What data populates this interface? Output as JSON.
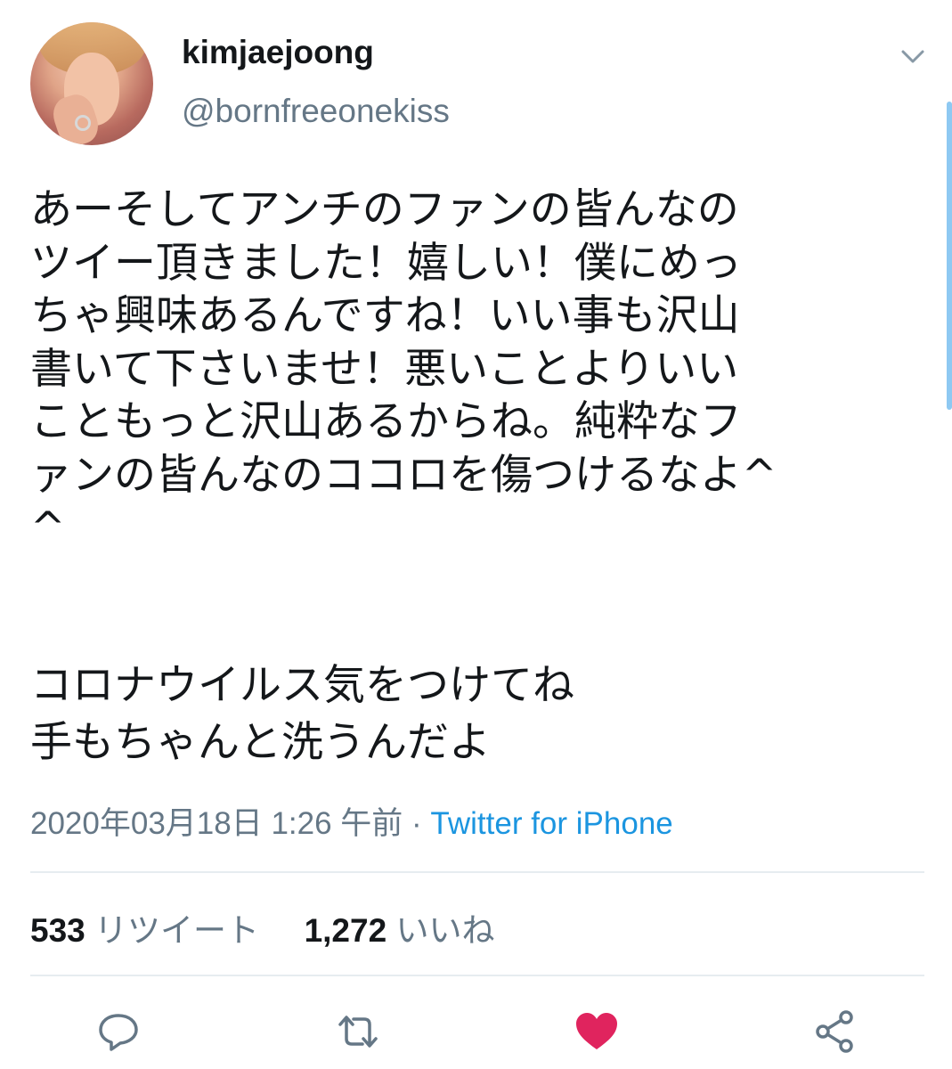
{
  "user": {
    "display_name": "kimjaejoong",
    "handle": "@bornfreeonekiss"
  },
  "tweet": {
    "text_main": "あーそしてアンチのファンの皆んなの\nツイー頂きました！嬉しい！僕にめっ\nちゃ興味あるんですね！いい事も沢山\n書いて下さいませ！悪いことよりいい\nこともっと沢山あるからね。純粋なフ\nァンの皆んなのココロを傷つけるなよ^\n^",
    "text_second": "コロナウイルス気をつけてね\n手もちゃんと洗うんだよ",
    "timestamp": "2020年03月18日 1:26 午前",
    "separator": " · ",
    "source": "Twitter for iPhone"
  },
  "stats": {
    "retweets_count": "533",
    "retweets_label": "リツイート",
    "likes_count": "1,272",
    "likes_label": "いいね"
  },
  "icons": {
    "more": "chevron-down-icon",
    "reply": "reply-icon",
    "retweet": "retweet-icon",
    "like": "heart-icon",
    "share": "share-icon"
  },
  "colors": {
    "secondary_text": "#657786",
    "link": "#1b95e0",
    "like_active": "#e0245e",
    "icon_gray": "#657786"
  }
}
